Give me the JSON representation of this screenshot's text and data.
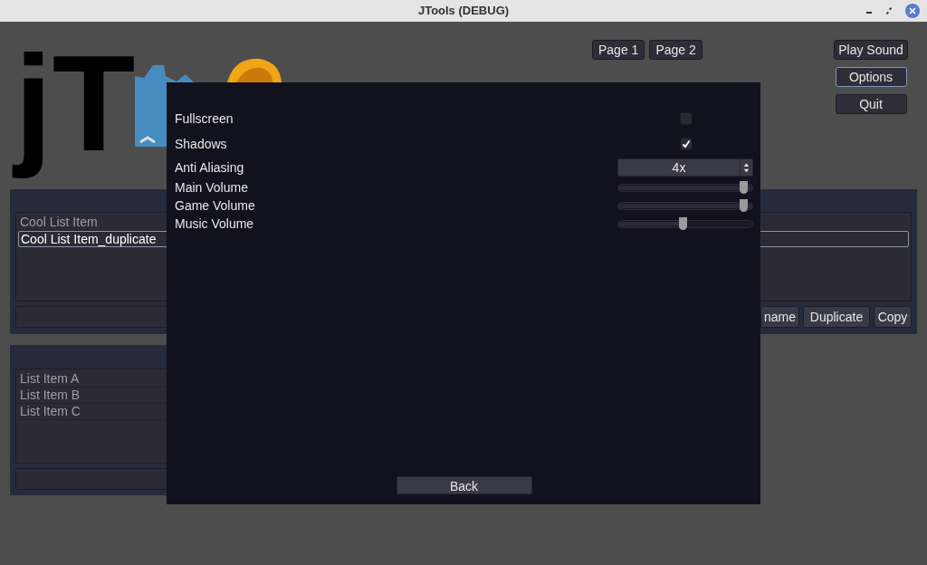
{
  "window": {
    "title": "JTools (DEBUG)"
  },
  "logo": {
    "text": "jT"
  },
  "page_buttons": [
    {
      "label": "Page 1"
    },
    {
      "label": "Page 2"
    }
  ],
  "menu_buttons": [
    {
      "label": "Play Sound",
      "focused": false
    },
    {
      "label": "Options",
      "focused": true
    },
    {
      "label": "Quit",
      "focused": false
    }
  ],
  "list_panel": {
    "items": [
      {
        "label": "Cool List Item",
        "selected": false
      },
      {
        "label": "Cool List Item_duplicate",
        "selected": true
      }
    ],
    "buttons": [
      "name",
      "Duplicate",
      "Copy"
    ]
  },
  "second_panel": {
    "items": [
      {
        "label": "List Item A",
        "selected": false
      },
      {
        "label": "List Item B",
        "selected": false
      },
      {
        "label": "List Item C",
        "selected": false
      }
    ]
  },
  "options_dialog": {
    "settings": [
      {
        "kind": "checkbox",
        "label": "Fullscreen",
        "checked": false
      },
      {
        "kind": "checkbox",
        "label": "Shadows",
        "checked": true
      },
      {
        "kind": "select",
        "label": "Anti Aliasing",
        "value": "4x"
      },
      {
        "kind": "slider",
        "label": "Main Volume",
        "level": 1
      },
      {
        "kind": "slider",
        "label": "Game Volume",
        "level": 1
      },
      {
        "kind": "slider",
        "label": "Music Volume",
        "level": 0.5
      }
    ],
    "back_button": "Back"
  }
}
